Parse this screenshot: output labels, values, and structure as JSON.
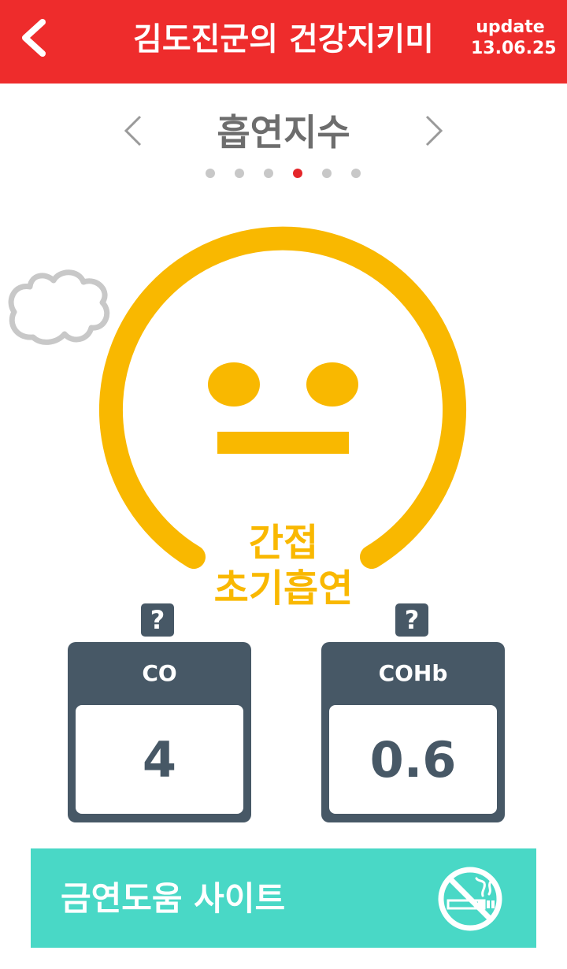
{
  "header": {
    "title": "김도진군의 건강지키미",
    "update_label": "update",
    "update_date": "13.06.25",
    "back_icon": "chevron-left-icon"
  },
  "section": {
    "title": "흡연지수",
    "prev_icon": "chevron-left-icon",
    "next_icon": "chevron-right-icon",
    "page_count": 6,
    "active_page": 4
  },
  "status": {
    "line1": "간접",
    "line2": "초기흡연"
  },
  "metrics": [
    {
      "label": "CO",
      "value": "4",
      "help": "?"
    },
    {
      "label": "COHb",
      "value": "0.6",
      "help": "?"
    }
  ],
  "banner": {
    "label": "금연도움 사이트",
    "icon": "no-smoking-icon"
  },
  "colors": {
    "header_bg": "#ee2c2c",
    "face": "#f9b800",
    "card": "#475866",
    "banner": "#49d8c6",
    "active_dot": "#e4262a",
    "cloud": "#c8c8c8"
  }
}
